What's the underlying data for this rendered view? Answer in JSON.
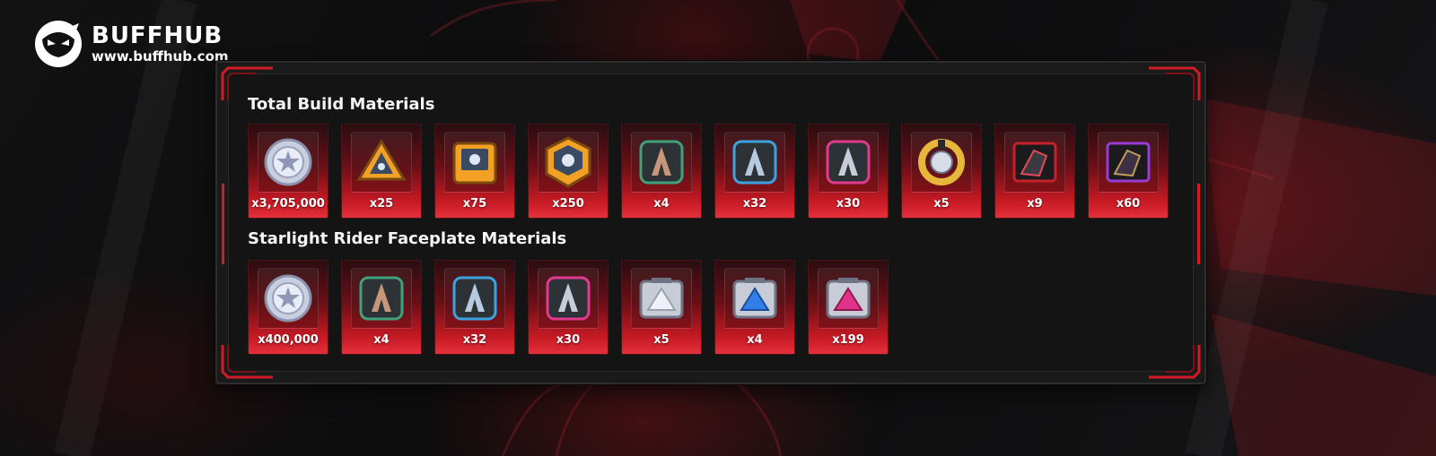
{
  "brand": {
    "name": "BUFFHUB",
    "url": "www.buffhub.com"
  },
  "sections": [
    {
      "title": "Total Build Materials",
      "items": [
        {
          "icon": "silver-coin-icon",
          "qty": "x3,705,000"
        },
        {
          "icon": "orange-triangle-chip-icon",
          "qty": "x25"
        },
        {
          "icon": "orange-square-chip-icon",
          "qty": "x75"
        },
        {
          "icon": "orange-hexagon-chip-icon",
          "qty": "x250"
        },
        {
          "icon": "green-fang-material-icon",
          "qty": "x4"
        },
        {
          "icon": "blue-fang-material-icon",
          "qty": "x32"
        },
        {
          "icon": "pink-fang-material-icon",
          "qty": "x30"
        },
        {
          "icon": "gold-ring-core-icon",
          "qty": "x5"
        },
        {
          "icon": "red-crystal-shard-icon",
          "qty": "x9"
        },
        {
          "icon": "purple-crystal-shard-icon",
          "qty": "x60"
        }
      ]
    },
    {
      "title": "Starlight Rider Faceplate Materials",
      "items": [
        {
          "icon": "silver-coin-icon",
          "qty": "x400,000"
        },
        {
          "icon": "green-fang-material-icon",
          "qty": "x4"
        },
        {
          "icon": "blue-fang-material-icon",
          "qty": "x32"
        },
        {
          "icon": "pink-fang-material-icon",
          "qty": "x30"
        },
        {
          "icon": "silver-data-module-icon",
          "qty": "x5"
        },
        {
          "icon": "blue-data-module-icon",
          "qty": "x4"
        },
        {
          "icon": "pink-data-module-icon",
          "qty": "x199"
        }
      ]
    }
  ],
  "colors": {
    "accent": "#d21b25",
    "card_top": "#2a0d10",
    "card_bottom": "#e4303a",
    "panel": "#141415"
  }
}
